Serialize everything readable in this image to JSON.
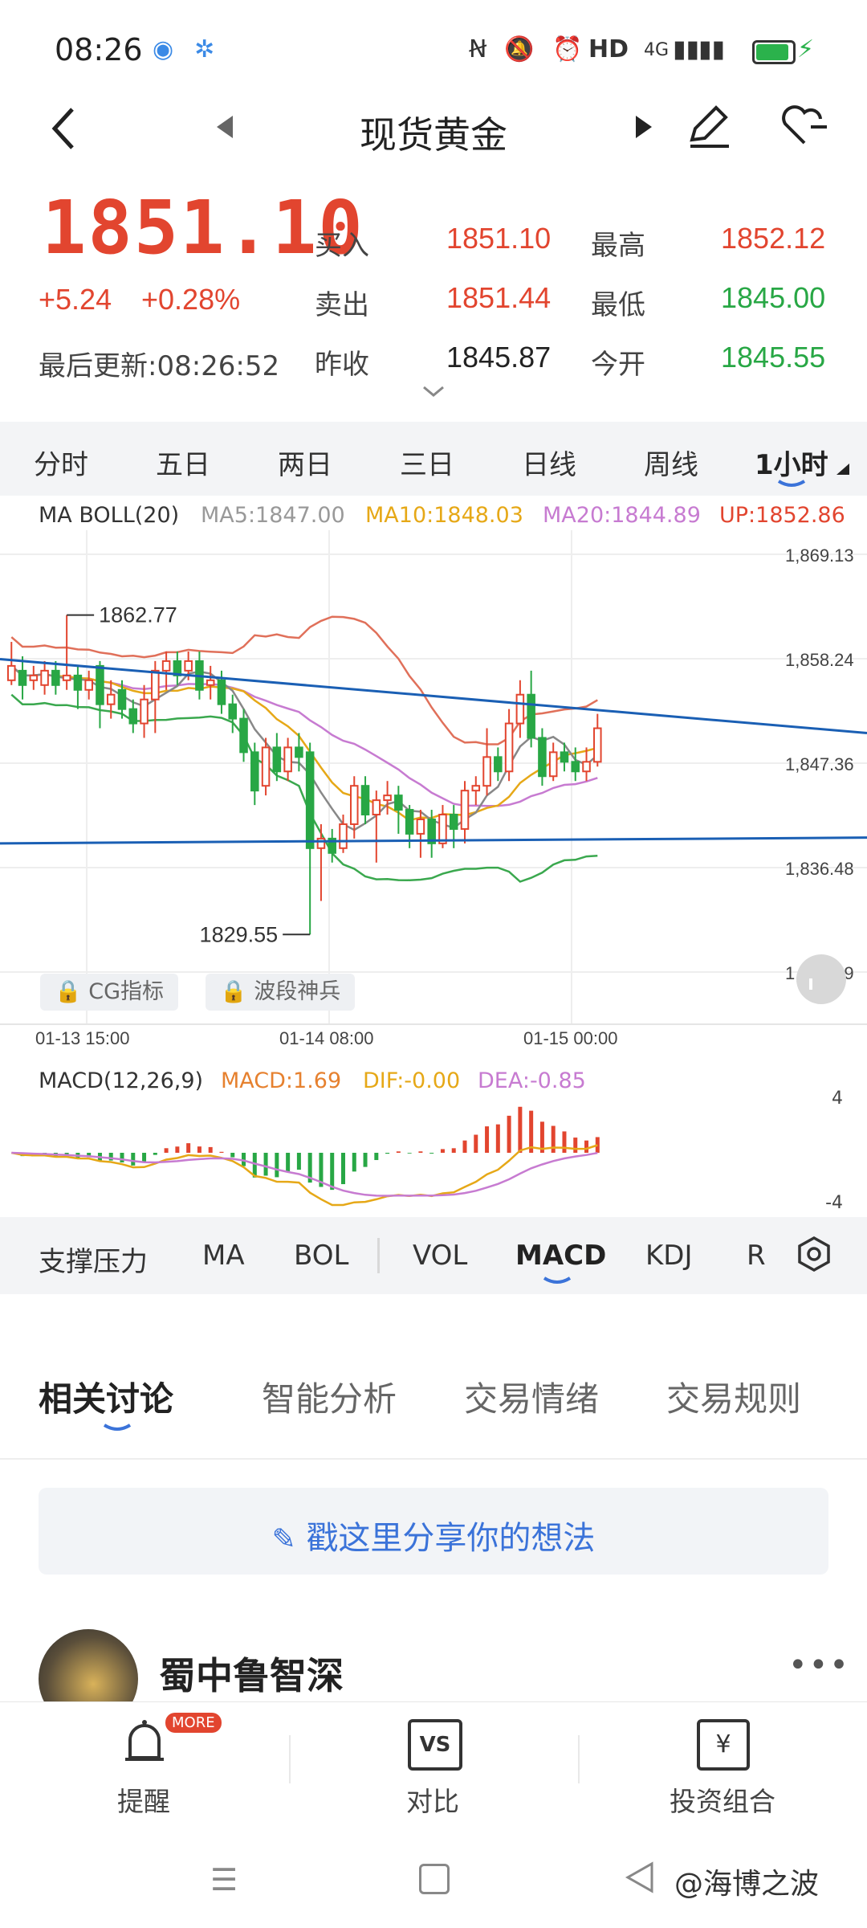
{
  "status": {
    "time": "08:26",
    "network": "4G",
    "hd": "HD"
  },
  "header": {
    "title": "现货黄金"
  },
  "quote": {
    "last_price": "1851.10",
    "change": "+5.24",
    "change_pct": "+0.28%",
    "updated": "最后更新:08:26:52",
    "buy_label": "买入",
    "buy": "1851.10",
    "sell_label": "卖出",
    "sell": "1851.44",
    "prev_label": "昨收",
    "prev": "1845.87",
    "high_label": "最高",
    "high": "1852.12",
    "low_label": "最低",
    "low": "1845.00",
    "open_label": "今开",
    "open": "1845.55"
  },
  "period_tabs": [
    "分时",
    "五日",
    "两日",
    "三日",
    "日线",
    "周线",
    "1小时"
  ],
  "chart_data": {
    "type": "candlestick",
    "indicator": "MA BOLL(20)",
    "legend": {
      "ma5": "MA5:1847.00",
      "ma10": "MA10:1848.03",
      "ma20": "MA20:1844.89",
      "up": "UP:1852.86"
    },
    "y_ticks": [
      "1,869.13",
      "1,858.24",
      "1,847.36",
      "1,836.48",
      "1,825.59"
    ],
    "ylim": [
      1825.59,
      1869.13
    ],
    "x_ticks": [
      "01-13 15:00",
      "01-14 08:00",
      "01-15 00:00"
    ],
    "annotations": {
      "high_mark": "1862.77",
      "low_mark": "1829.55"
    },
    "candles": [
      [
        1856,
        1857.5,
        1860,
        1855.5
      ],
      [
        1857,
        1855.5,
        1858.5,
        1854
      ],
      [
        1856,
        1856.5,
        1857.5,
        1855
      ],
      [
        1855.5,
        1857,
        1858,
        1854.5
      ],
      [
        1857,
        1855.5,
        1858,
        1854.5
      ],
      [
        1856,
        1856.5,
        1862.8,
        1855
      ],
      [
        1856.5,
        1855,
        1857.5,
        1853
      ],
      [
        1855,
        1856,
        1857,
        1854
      ],
      [
        1857.5,
        1853.5,
        1858,
        1851
      ],
      [
        1853.5,
        1854.5,
        1856,
        1852
      ],
      [
        1855,
        1853,
        1856,
        1852
      ],
      [
        1853,
        1851.5,
        1854,
        1850.5
      ],
      [
        1851.5,
        1854,
        1855.5,
        1850
      ],
      [
        1854,
        1857,
        1858,
        1850.5
      ],
      [
        1857,
        1858,
        1859,
        1855
      ],
      [
        1858,
        1856.5,
        1859,
        1855.5
      ],
      [
        1857,
        1858,
        1859,
        1856
      ],
      [
        1858,
        1855,
        1859,
        1854
      ],
      [
        1855.5,
        1856,
        1857.5,
        1854
      ],
      [
        1856,
        1853.5,
        1857,
        1852.5
      ],
      [
        1853.5,
        1852,
        1854.5,
        1850.5
      ],
      [
        1852,
        1848.5,
        1853,
        1847.5
      ],
      [
        1848.5,
        1844.5,
        1849.5,
        1843
      ],
      [
        1845,
        1849,
        1850,
        1844
      ],
      [
        1849,
        1846.5,
        1850.5,
        1845.5
      ],
      [
        1846.5,
        1849,
        1850,
        1845.5
      ],
      [
        1849,
        1848,
        1850.5,
        1846.5
      ],
      [
        1848.5,
        1838.5,
        1849.5,
        1829.5
      ],
      [
        1838.5,
        1839.5,
        1841,
        1833
      ],
      [
        1839.5,
        1838,
        1840.5,
        1837
      ],
      [
        1838.5,
        1841,
        1842,
        1838
      ],
      [
        1841,
        1845,
        1846,
        1839.5
      ],
      [
        1845,
        1842,
        1846,
        1841
      ],
      [
        1842,
        1843.5,
        1844.5,
        1837
      ],
      [
        1843.5,
        1844,
        1845.5,
        1842
      ],
      [
        1844,
        1842.5,
        1845,
        1840
      ],
      [
        1842.5,
        1840,
        1843,
        1838.5
      ],
      [
        1840,
        1841.5,
        1842.5,
        1837.5
      ],
      [
        1841.5,
        1839,
        1842.5,
        1837.5
      ],
      [
        1839,
        1842,
        1843,
        1838.5
      ],
      [
        1842,
        1840.5,
        1843,
        1838.5
      ],
      [
        1840.5,
        1844.5,
        1845.5,
        1839
      ],
      [
        1844.5,
        1845,
        1846,
        1843
      ],
      [
        1845,
        1848,
        1851,
        1844
      ],
      [
        1848,
        1846.5,
        1849,
        1845.5
      ],
      [
        1846.5,
        1851.5,
        1853,
        1845.5
      ],
      [
        1851.5,
        1854.5,
        1856,
        1850
      ],
      [
        1854.5,
        1850,
        1857,
        1849
      ],
      [
        1850,
        1846,
        1851,
        1845
      ],
      [
        1846,
        1848.5,
        1849.5,
        1845.5
      ],
      [
        1848.5,
        1847.5,
        1849.5,
        1846.5
      ],
      [
        1847.5,
        1846.5,
        1849,
        1845.5
      ],
      [
        1846.5,
        1847.5,
        1849,
        1845.5
      ],
      [
        1847.5,
        1851,
        1852.5,
        1847
      ]
    ],
    "macd": {
      "label": "MACD(12,26,9)",
      "macd": "MACD:1.69",
      "dif": "DIF:-0.00",
      "dea": "DEA:-0.85",
      "y_ticks": [
        "4",
        "-4"
      ],
      "ylim": [
        -4,
        4
      ]
    }
  },
  "tags": {
    "cg": "CG指标",
    "wave": "波段神兵"
  },
  "indicator_tabs": [
    "支撑压力",
    "MA",
    "BOL",
    "VOL",
    "MACD",
    "KDJ",
    "R"
  ],
  "discussion": {
    "tabs": [
      "相关讨论",
      "智能分析",
      "交易情绪",
      "交易规则"
    ],
    "post_placeholder": "戳这里分享你的想法",
    "first_user": "蜀中鲁智深"
  },
  "bottom_nav": {
    "remind": "提醒",
    "remind_badge": "MORE",
    "compare": "对比",
    "portfolio": "投资组合",
    "watermark": "@海博之波"
  },
  "colors": {
    "up": "#e2452f",
    "down": "#28a745",
    "ma5": "#888888",
    "ma10": "#e6a817",
    "ma20": "#c77bd1",
    "boll_up": "#e0705a",
    "boll_low": "#3aa84e",
    "trend": "#1a5fb4"
  }
}
